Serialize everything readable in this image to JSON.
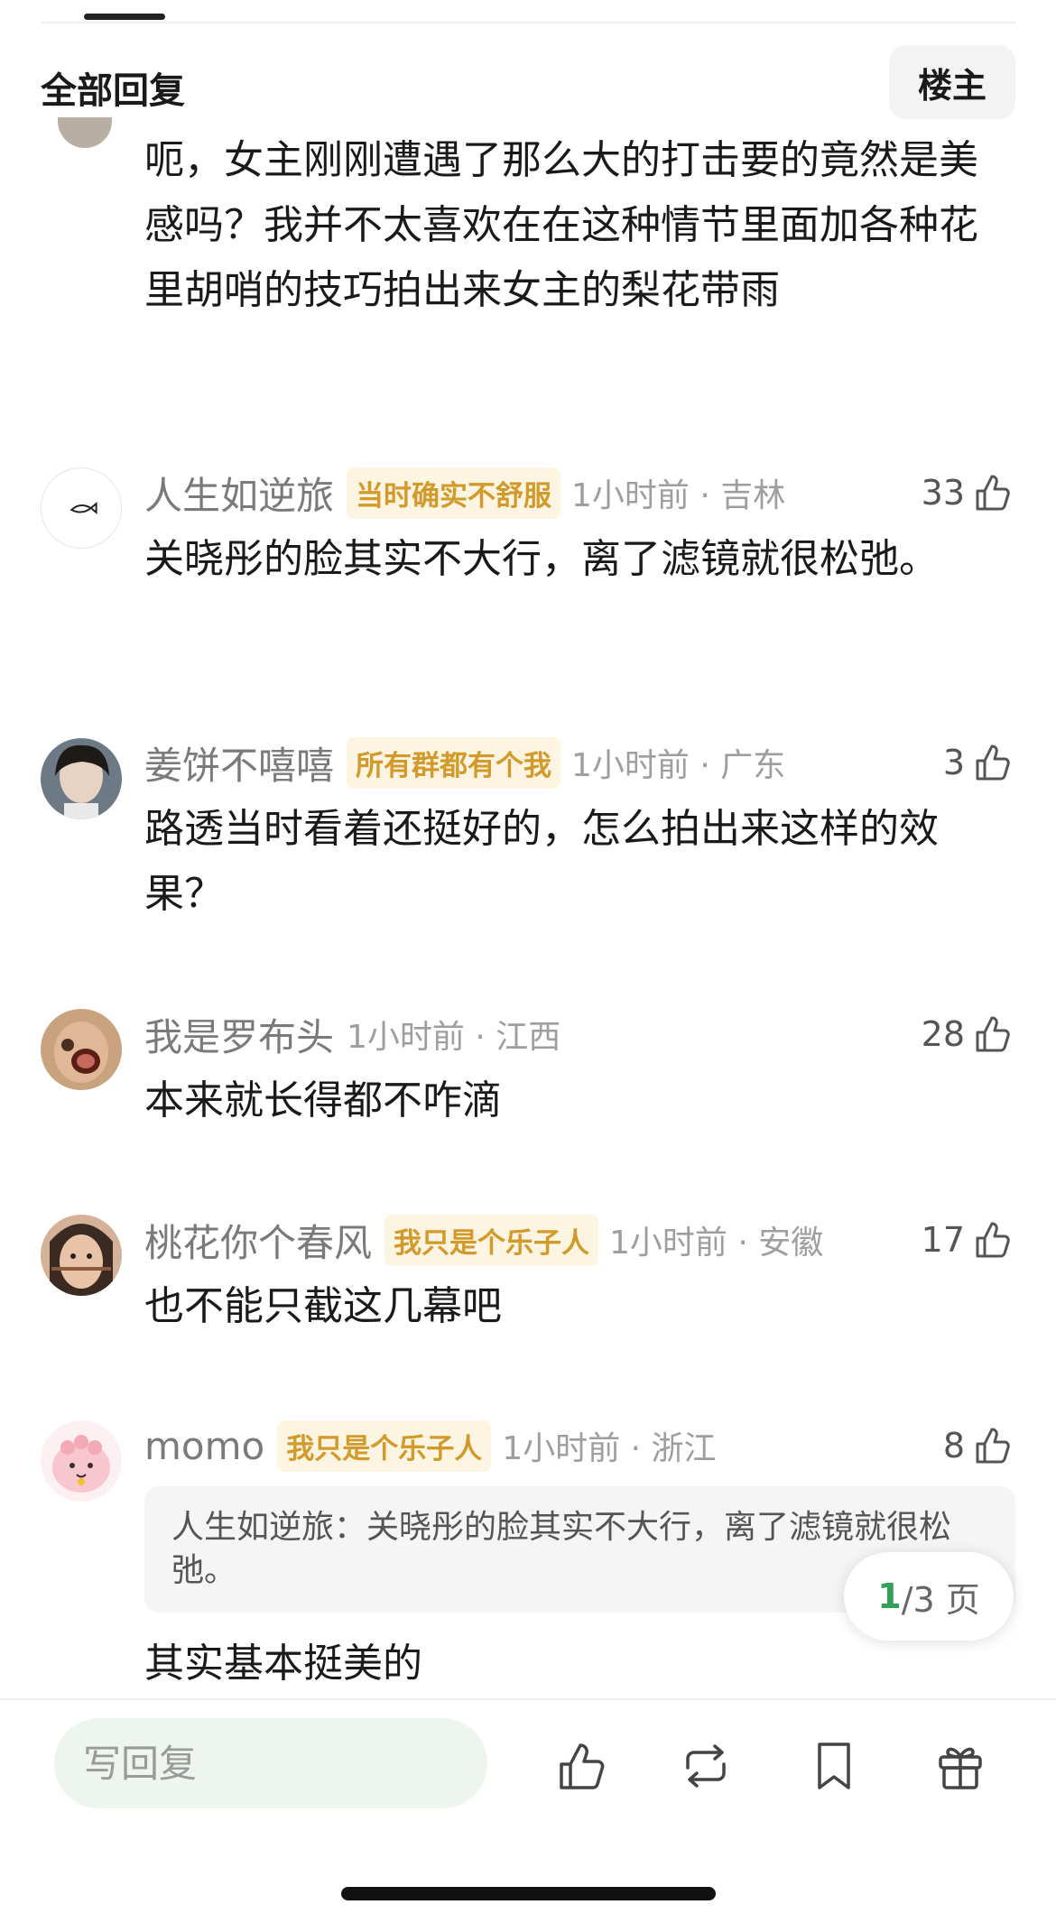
{
  "header": {
    "title": "全部回复",
    "op_button": "楼主"
  },
  "comments": [
    {
      "text": "呃，女主刚刚遭遇了那么大的打击要的竟然是美感吗？我并不太喜欢在在这种情节里面加各种花里胡哨的技巧拍出来女主的梨花带雨"
    },
    {
      "username": "人生如逆旅",
      "badge": "当时确实不舒服",
      "time_loc": "1小时前 · 吉林",
      "likes": "33",
      "text": "关晓彤的脸其实不大行，离了滤镜就很松弛。"
    },
    {
      "username": "姜饼不嘻嘻",
      "badge": "所有群都有个我",
      "time_loc": "1小时前 · 广东",
      "likes": "3",
      "text": "路透当时看着还挺好的，怎么拍出来这样的效果？"
    },
    {
      "username": "我是罗布头",
      "time_loc": "1小时前 · 江西",
      "likes": "28",
      "text": "本来就长得都不咋滴"
    },
    {
      "username": "桃花你个春风",
      "badge": "我只是个乐子人",
      "time_loc": "1小时前 · 安徽",
      "likes": "17",
      "text": "也不能只截这几幕吧"
    },
    {
      "username": "momo",
      "badge": "我只是个乐子人",
      "time_loc": "1小时前 · 浙江",
      "likes": "8",
      "quote": "人生如逆旅：关晓彤的脸其实不大行，离了滤镜就很松弛。",
      "text": "其实基本挺美的"
    }
  ],
  "pagination": {
    "current": "1",
    "rest": "/3 页"
  },
  "bottom_bar": {
    "reply_placeholder": "写回复"
  },
  "colors": {
    "accent_green": "#33a05a",
    "badge_bg": "#fdf4e2",
    "badge_text": "#d29a2a",
    "input_bg": "#eef5ef"
  },
  "icons": [
    "like-icon",
    "repost-icon",
    "bookmark-icon",
    "gift-icon"
  ]
}
